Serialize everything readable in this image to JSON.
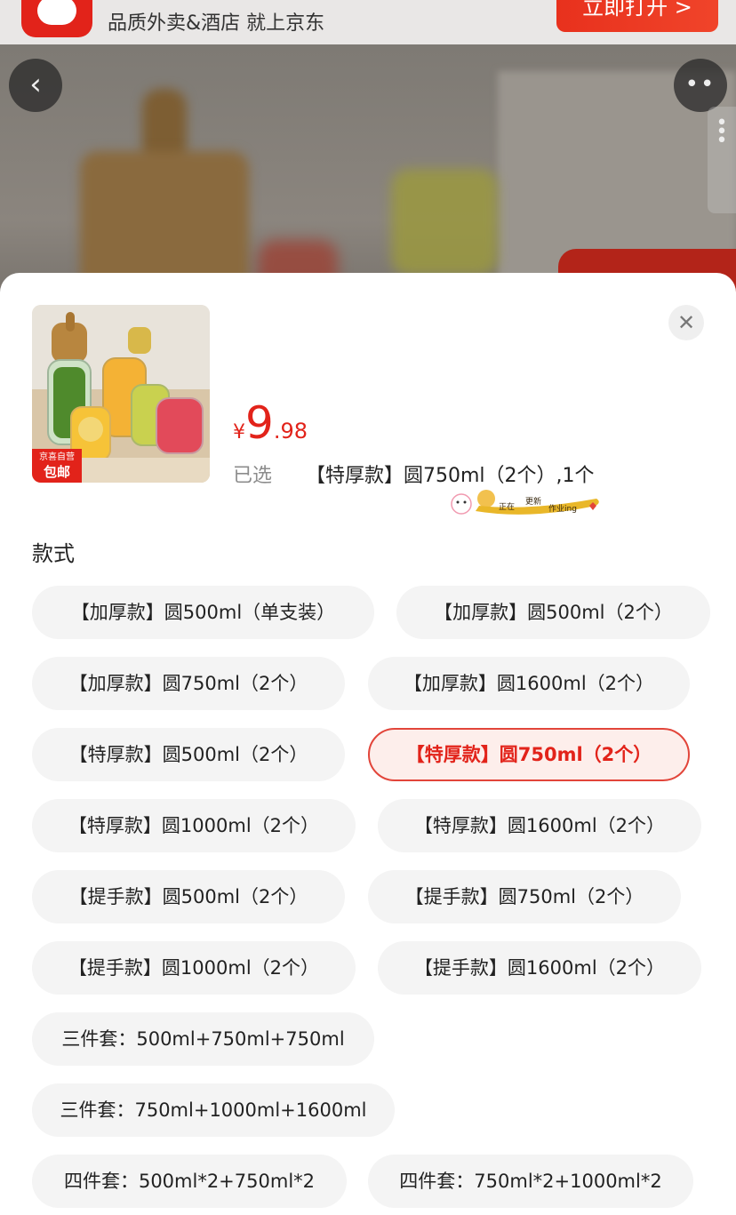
{
  "banner": {
    "slogan": "品质外卖&酒店 就上京东",
    "open_button": "立即打开 >"
  },
  "nav": {
    "back_icon": "chevron-left-icon",
    "more_icon": "more-dots-icon"
  },
  "product": {
    "badge_line1": "京喜自营",
    "badge_line2": "包邮",
    "price_currency": "¥",
    "price_integer": "9",
    "price_decimal": ".98",
    "selected_label": "已选",
    "selected_value": "【特厚款】圆750ml（2个）,1个",
    "sticker_text": "正在更新作业ing"
  },
  "section": {
    "title": "款式"
  },
  "options": [
    {
      "label": "【加厚款】圆500ml（单支装）",
      "selected": false
    },
    {
      "label": "【加厚款】圆500ml（2个）",
      "selected": false
    },
    {
      "label": "【加厚款】圆750ml（2个）",
      "selected": false
    },
    {
      "label": "【加厚款】圆1600ml（2个）",
      "selected": false
    },
    {
      "label": "【特厚款】圆500ml（2个）",
      "selected": false
    },
    {
      "label": "【特厚款】圆750ml（2个）",
      "selected": true
    },
    {
      "label": "【特厚款】圆1000ml（2个）",
      "selected": false
    },
    {
      "label": "【特厚款】圆1600ml（2个）",
      "selected": false
    },
    {
      "label": "【提手款】圆500ml（2个）",
      "selected": false
    },
    {
      "label": "【提手款】圆750ml（2个）",
      "selected": false
    },
    {
      "label": "【提手款】圆1000ml（2个）",
      "selected": false
    },
    {
      "label": "【提手款】圆1600ml（2个）",
      "selected": false
    },
    {
      "label": "三件套：500ml+750ml+750ml",
      "selected": false
    },
    {
      "label": "三件套：750ml+1000ml+1600ml",
      "selected": false
    },
    {
      "label": "四件套：500ml*2+750ml*2",
      "selected": false
    },
    {
      "label": "四件套：750ml*2+1000ml*2",
      "selected": false
    }
  ],
  "colors": {
    "accent": "#e2231a",
    "selected_bg": "#fdeeeb",
    "option_bg": "#f4f4f4"
  }
}
